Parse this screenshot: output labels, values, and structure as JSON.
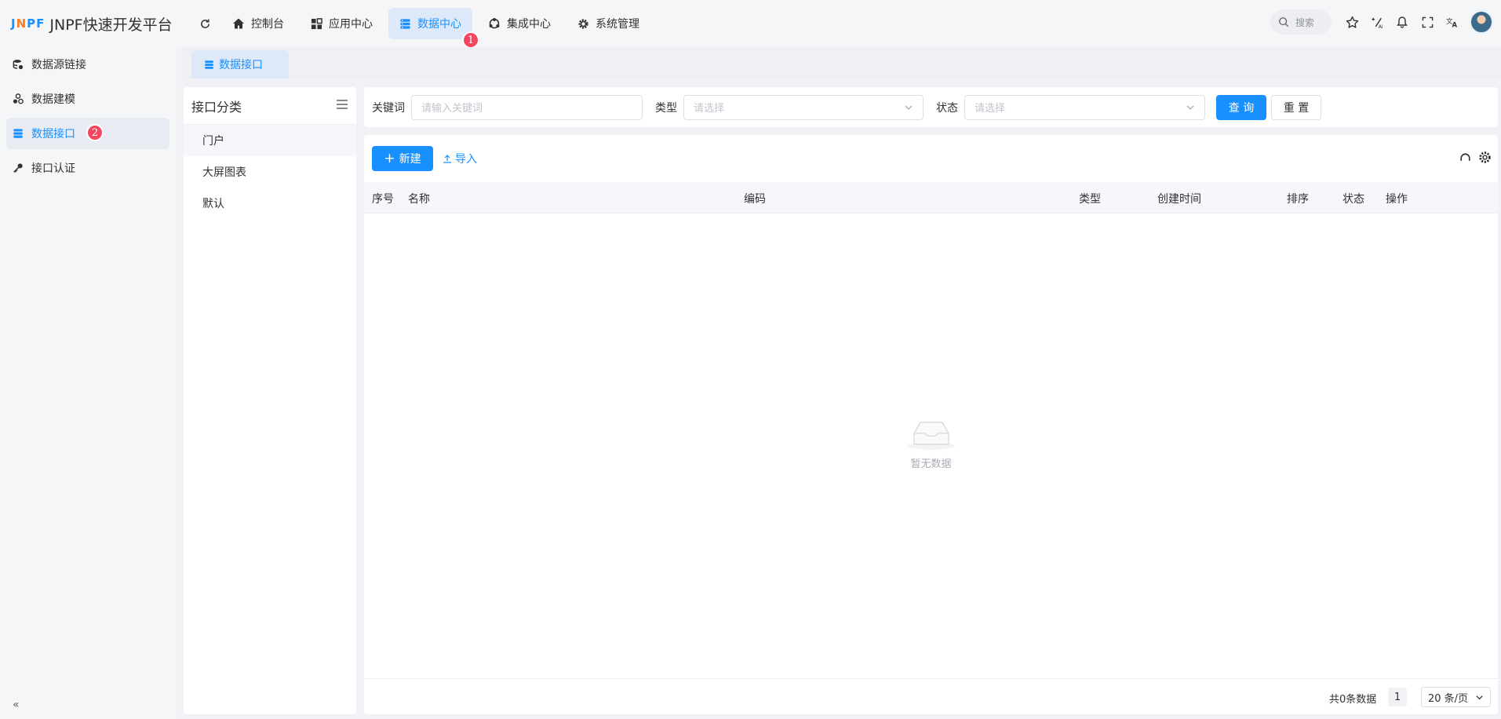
{
  "app": {
    "logo_mark_part1": "J",
    "logo_mark_part2": "N",
    "logo_mark_part3": "PF",
    "title": "JNPF快速开发平台"
  },
  "topnav": {
    "items": [
      {
        "label": "控制台",
        "icon": "home-icon"
      },
      {
        "label": "应用中心",
        "icon": "grid-icon"
      },
      {
        "label": "数据中心",
        "icon": "database-icon",
        "active": true
      },
      {
        "label": "集成中心",
        "icon": "integration-icon"
      },
      {
        "label": "系统管理",
        "icon": "gear-icon"
      }
    ],
    "badge1": "1"
  },
  "topright": {
    "search_label": "搜索",
    "icons": [
      "star-icon",
      "ai-sparkle-icon",
      "bell-icon",
      "fullscreen-icon",
      "translate-icon"
    ]
  },
  "sidebar": {
    "items": [
      {
        "label": "数据源链接",
        "icon": "datasource-icon"
      },
      {
        "label": "数据建模",
        "icon": "model-icon"
      },
      {
        "label": "数据接口",
        "icon": "api-icon",
        "active": true
      },
      {
        "label": "接口认证",
        "icon": "key-icon"
      }
    ],
    "badge2": "2",
    "collapse": "«"
  },
  "tab": {
    "label": "数据接口"
  },
  "category": {
    "title": "接口分类",
    "items": [
      "门户",
      "大屏图表",
      "默认"
    ]
  },
  "filter": {
    "keyword_label": "关键词",
    "keyword_placeholder": "请输入关键词",
    "type_label": "类型",
    "type_placeholder": "请选择",
    "status_label": "状态",
    "status_placeholder": "请选择",
    "query_button": "查 询",
    "reset_button": "重 置"
  },
  "toolbar": {
    "new_button": "新建",
    "import_link": "导入"
  },
  "table": {
    "columns": [
      "序号",
      "名称",
      "编码",
      "类型",
      "创建时间",
      "排序",
      "状态",
      "操作"
    ],
    "empty_text": "暂无数据"
  },
  "pagination": {
    "total": "共0条数据",
    "current_page": "1",
    "page_size": "20 条/页"
  },
  "colors": {
    "primary": "#1890ff",
    "badge": "#f5465f",
    "active_bg": "#dde9f8"
  }
}
